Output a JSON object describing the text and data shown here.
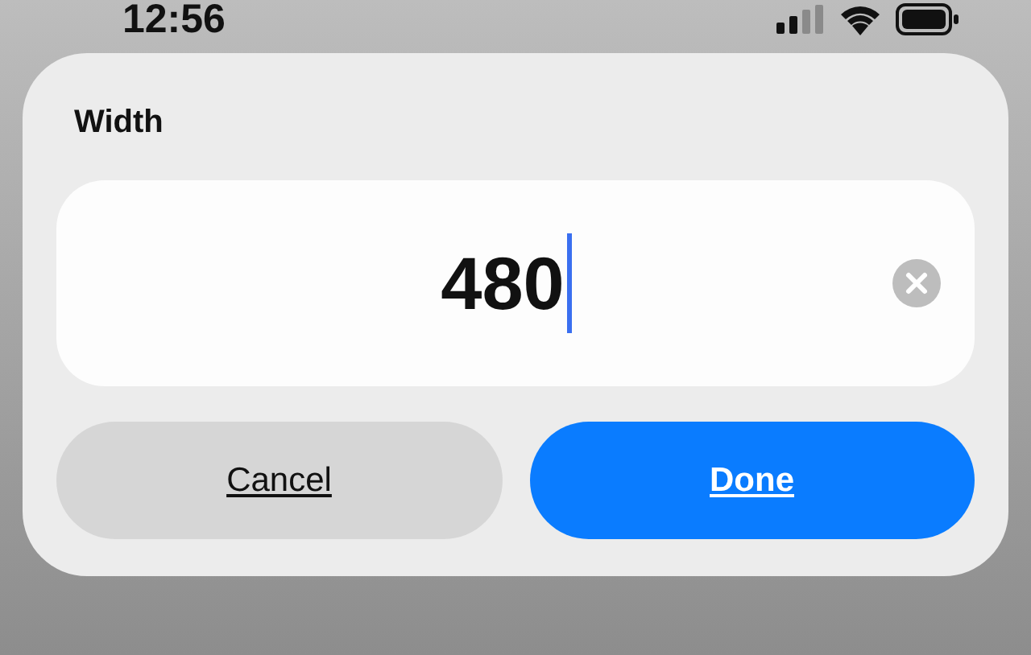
{
  "status_bar": {
    "time": "12:56"
  },
  "dialog": {
    "title": "Width",
    "field": {
      "value": "480",
      "focused": true
    },
    "buttons": [
      {
        "label": "Cancel",
        "kind": "secondary"
      },
      {
        "label": "Done",
        "kind": "primary"
      }
    ]
  }
}
